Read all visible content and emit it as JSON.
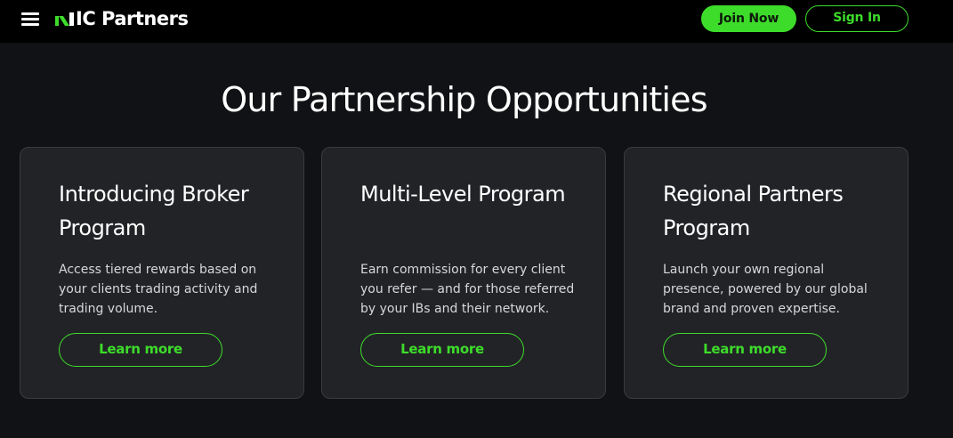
{
  "header": {
    "logo_text": "IC Partners",
    "join_label": "Join Now",
    "signin_label": "Sign In"
  },
  "colors": {
    "accent": "#3ddc2a",
    "background": "#111215",
    "card": "#222327"
  },
  "main": {
    "title": "Our Partnership Opportunities",
    "cards": [
      {
        "title": "Introducing Broker Program",
        "description": "Access tiered rewards based on your clients trading activity and trading volume.",
        "button_label": "Learn more"
      },
      {
        "title": "Multi-Level Program",
        "description": "Earn commission for every client you refer — and for those referred by your IBs and their network.",
        "button_label": "Learn more"
      },
      {
        "title": "Regional Partners Program",
        "description": "Launch your own regional presence, powered by our global brand and proven expertise.",
        "button_label": "Learn more"
      }
    ]
  }
}
